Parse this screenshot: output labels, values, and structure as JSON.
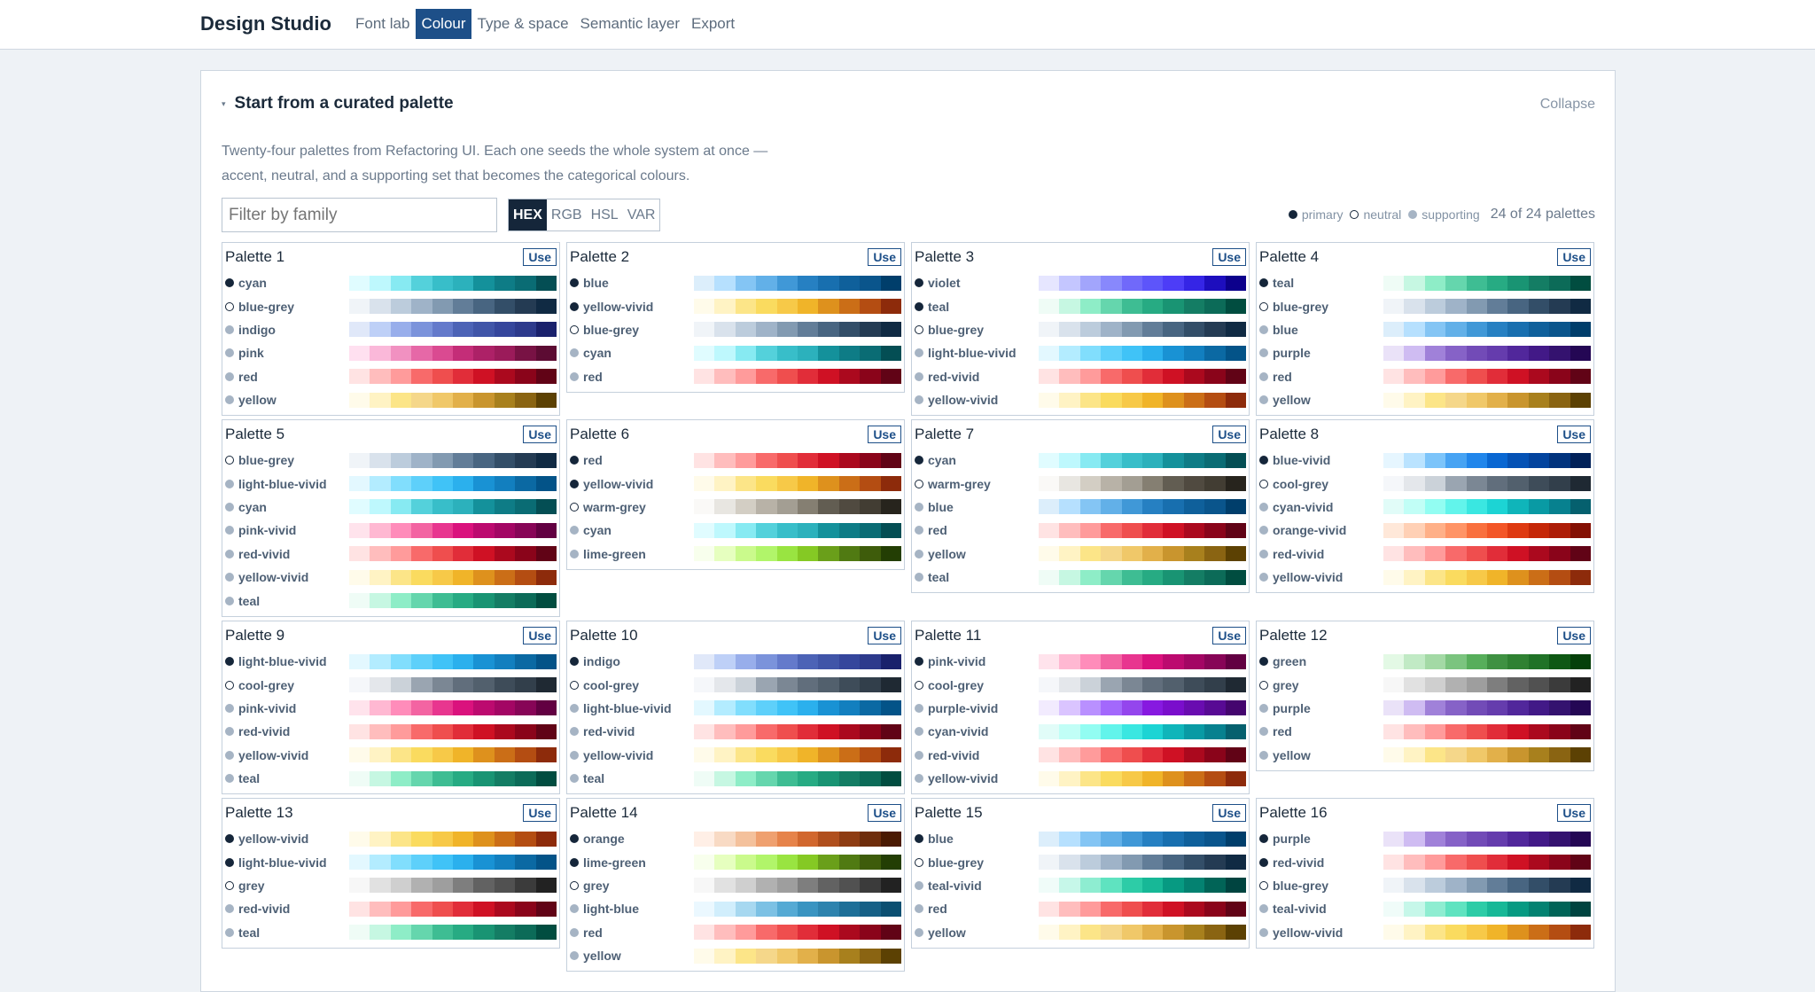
{
  "app": {
    "title": "Design Studio"
  },
  "nav": [
    {
      "label": "Font lab",
      "active": false
    },
    {
      "label": "Colour",
      "active": true
    },
    {
      "label": "Type & space",
      "active": false
    },
    {
      "label": "Semantic layer",
      "active": false
    },
    {
      "label": "Export",
      "active": false
    }
  ],
  "section": {
    "title": "Start from a curated palette",
    "collapse_label": "Collapse",
    "description_line1": "Twenty-four palettes from Refactoring UI. Each one seeds the whole system at once —",
    "description_line2": "accent, neutral, and a supporting set that becomes the categorical colours.",
    "filter_placeholder": "Filter by family",
    "formats": [
      {
        "label": "HEX",
        "active": true
      },
      {
        "label": "RGB",
        "active": false
      },
      {
        "label": "HSL",
        "active": false
      },
      {
        "label": "VAR",
        "active": false
      }
    ],
    "legend": {
      "primary": "primary",
      "neutral": "neutral",
      "supporting": "supporting"
    },
    "count_label": "24 of 24 palettes"
  },
  "use_label": "Use",
  "colors": {
    "primary_dot": "#15263a",
    "supporting_dot": "#a6b4c4",
    "accent": "#1d4f88"
  },
  "ramps": {
    "cyan": [
      "#e0fcff",
      "#bef8fd",
      "#87eaf2",
      "#54d1db",
      "#38bec9",
      "#2cb1bc",
      "#14919b",
      "#0e7c86",
      "#0a6c74",
      "#044e54"
    ],
    "blue-grey": [
      "#f0f4f8",
      "#d9e2ec",
      "#bcccdc",
      "#9fb3c8",
      "#829ab1",
      "#627d98",
      "#486581",
      "#334e68",
      "#243b53",
      "#102a43"
    ],
    "indigo": [
      "#e0e8f9",
      "#bed0f7",
      "#98aeeb",
      "#7b93db",
      "#647acb",
      "#4c63b6",
      "#4055a8",
      "#35469c",
      "#2d3a8c",
      "#19216c"
    ],
    "pink": [
      "#ffe0f0",
      "#fab8d9",
      "#f191c1",
      "#e668a7",
      "#da4a91",
      "#c42d78",
      "#ad2167",
      "#9b1b5a",
      "#781244",
      "#5c0b33"
    ],
    "red": [
      "#ffe3e3",
      "#ffbdbd",
      "#ff9b9b",
      "#f86a6a",
      "#ef4e4e",
      "#e12d39",
      "#cf1124",
      "#ab091e",
      "#8a041a",
      "#610316"
    ],
    "yellow": [
      "#fffbea",
      "#fff3c4",
      "#fce588",
      "#fadb5f",
      "#f7c948",
      "#f0b429",
      "#de911d",
      "#cb6e17",
      "#b44d12",
      "#8d2b0b"
    ],
    "yellow-o": [
      "#fffbea",
      "#fff3c4",
      "#fce588",
      "#f5d78a",
      "#f0c869",
      "#e2b04a",
      "#c9952e",
      "#a8801d",
      "#8a6412",
      "#5c4103"
    ],
    "blue": [
      "#dceefb",
      "#b6e0fe",
      "#84c5f4",
      "#62b0e8",
      "#4098d7",
      "#2680c2",
      "#186faf",
      "#0f609b",
      "#0a558c",
      "#003e6b"
    ],
    "yellow-vivid": [
      "#fffbea",
      "#fff3c4",
      "#fce588",
      "#fadb5f",
      "#f7c948",
      "#f0b429",
      "#de911d",
      "#cb6e17",
      "#b44d12",
      "#8d2b0b"
    ],
    "violet": [
      "#e6e6ff",
      "#c4c6ff",
      "#a2a5fc",
      "#8888fc",
      "#7069fa",
      "#5d55fa",
      "#4d3df7",
      "#3525e6",
      "#1d0ebe",
      "#0c008c"
    ],
    "teal": [
      "#effcf6",
      "#c6f7e2",
      "#8eedc7",
      "#65d6ad",
      "#3ebd93",
      "#27ab83",
      "#199473",
      "#147d64",
      "#0c6b58",
      "#014d40"
    ],
    "light-blue-vivid": [
      "#e3f8ff",
      "#b3ecff",
      "#81defd",
      "#5ed0fa",
      "#40c3f7",
      "#2bb0ed",
      "#1992d4",
      "#127fbf",
      "#0b69a3",
      "#035388"
    ],
    "red-vivid": [
      "#ffe3e3",
      "#ffbdbd",
      "#ff9b9b",
      "#f86a6a",
      "#ef4e4e",
      "#e12d39",
      "#cf1124",
      "#ab091e",
      "#8a041a",
      "#610316"
    ],
    "purple": [
      "#eae2f8",
      "#cfbcf2",
      "#a081d9",
      "#8662c7",
      "#724bb7",
      "#653cad",
      "#51279b",
      "#421987",
      "#34126f",
      "#240754"
    ],
    "pink-vivid": [
      "#ffe3ec",
      "#ffb8d2",
      "#ff8cba",
      "#f364a2",
      "#e8368f",
      "#da127d",
      "#bc0a6f",
      "#a30664",
      "#870557",
      "#620042"
    ],
    "warm-grey": [
      "#faf9f7",
      "#e8e6e1",
      "#d3cec4",
      "#b8b2a7",
      "#a39e93",
      "#857f72",
      "#625d52",
      "#504a40",
      "#423d33",
      "#27241d"
    ],
    "lime-green": [
      "#f8ffed",
      "#e6ffbf",
      "#cafa8c",
      "#b1f56a",
      "#99e441",
      "#85c924",
      "#6a9f1a",
      "#507a12",
      "#3e5c0b",
      "#233e04"
    ],
    "blue-vivid": [
      "#e6f6ff",
      "#bae3ff",
      "#7cc4fa",
      "#47a3f3",
      "#2186eb",
      "#0967d2",
      "#0552b5",
      "#03449e",
      "#01337d",
      "#002159"
    ],
    "cool-grey": [
      "#f5f7fa",
      "#e4e7eb",
      "#cbd2d9",
      "#9aa5b1",
      "#7b8794",
      "#616e7c",
      "#52606d",
      "#3e4c59",
      "#323f4b",
      "#1f2933"
    ],
    "cyan-vivid": [
      "#e1fcf8",
      "#c1fef6",
      "#92fdf2",
      "#62f4eb",
      "#3ae7e1",
      "#1cd4d4",
      "#0fb5ba",
      "#099aa4",
      "#07818f",
      "#05606e"
    ],
    "orange-vivid": [
      "#ffe8d9",
      "#ffd0b5",
      "#ffb088",
      "#ff9466",
      "#f9703e",
      "#f35627",
      "#de3a11",
      "#c52707",
      "#ad1d07",
      "#841003"
    ],
    "grey": [
      "#f7f7f7",
      "#e1e1e1",
      "#cfcfcf",
      "#b1b1b1",
      "#9e9e9e",
      "#7e7e7e",
      "#626262",
      "#515151",
      "#3b3b3b",
      "#222222"
    ],
    "green": [
      "#e3f9e5",
      "#c1eac5",
      "#a3d9a5",
      "#7bc47f",
      "#57ae5b",
      "#3f9142",
      "#2f8132",
      "#207227",
      "#0e5814",
      "#05400a"
    ],
    "purple-vivid": [
      "#f2ebfe",
      "#dac4ff",
      "#b990ff",
      "#a368fc",
      "#9446ed",
      "#8719e0",
      "#7a0ecc",
      "#690cb0",
      "#580a94",
      "#44056e"
    ],
    "teal-vivid": [
      "#f0fcf9",
      "#c6f7e9",
      "#8eedd1",
      "#5fe3c0",
      "#2dcca7",
      "#17b897",
      "#079a82",
      "#048271",
      "#016457",
      "#004440"
    ],
    "orange": [
      "#fffaeb",
      "#fcefc7",
      "#f8e3a3",
      "#f9da8b",
      "#f7d070",
      "#e9b949",
      "#c99a2e",
      "#a27c1a",
      "#7c5e10",
      "#513c06"
    ],
    "orange-r": [
      "#ffefe6",
      "#f8dac4",
      "#f4c19c",
      "#efa06f",
      "#e6834a",
      "#d1672e",
      "#b04f1d",
      "#8e3c12",
      "#6e2d0b",
      "#4a1a02"
    ],
    "light-blue": [
      "#ebf8ff",
      "#d1eefc",
      "#a7d8f0",
      "#7cc1e4",
      "#55aad4",
      "#3994c1",
      "#2d83ae",
      "#1d6f98",
      "#166086",
      "#0b4f71"
    ]
  },
  "palettes": [
    {
      "name": "Palette 1",
      "rows": [
        {
          "role": "primary",
          "family": "cyan",
          "ramp": "cyan"
        },
        {
          "role": "neutral",
          "family": "blue-grey",
          "ramp": "blue-grey"
        },
        {
          "role": "supporting",
          "family": "indigo",
          "ramp": "indigo"
        },
        {
          "role": "supporting",
          "family": "pink",
          "ramp": "pink"
        },
        {
          "role": "supporting",
          "family": "red",
          "ramp": "red"
        },
        {
          "role": "supporting",
          "family": "yellow",
          "ramp": "yellow-o"
        }
      ]
    },
    {
      "name": "Palette 2",
      "rows": [
        {
          "role": "primary",
          "family": "blue",
          "ramp": "blue"
        },
        {
          "role": "primary",
          "family": "yellow-vivid",
          "ramp": "yellow-vivid"
        },
        {
          "role": "neutral",
          "family": "blue-grey",
          "ramp": "blue-grey"
        },
        {
          "role": "supporting",
          "family": "cyan",
          "ramp": "cyan"
        },
        {
          "role": "supporting",
          "family": "red",
          "ramp": "red"
        }
      ]
    },
    {
      "name": "Palette 3",
      "rows": [
        {
          "role": "primary",
          "family": "violet",
          "ramp": "violet"
        },
        {
          "role": "primary",
          "family": "teal",
          "ramp": "teal"
        },
        {
          "role": "neutral",
          "family": "blue-grey",
          "ramp": "blue-grey"
        },
        {
          "role": "supporting",
          "family": "light-blue-vivid",
          "ramp": "light-blue-vivid"
        },
        {
          "role": "supporting",
          "family": "red-vivid",
          "ramp": "red-vivid"
        },
        {
          "role": "supporting",
          "family": "yellow-vivid",
          "ramp": "yellow-vivid"
        }
      ]
    },
    {
      "name": "Palette 4",
      "rows": [
        {
          "role": "primary",
          "family": "teal",
          "ramp": "teal"
        },
        {
          "role": "neutral",
          "family": "blue-grey",
          "ramp": "blue-grey"
        },
        {
          "role": "supporting",
          "family": "blue",
          "ramp": "blue"
        },
        {
          "role": "supporting",
          "family": "purple",
          "ramp": "purple"
        },
        {
          "role": "supporting",
          "family": "red",
          "ramp": "red"
        },
        {
          "role": "supporting",
          "family": "yellow",
          "ramp": "yellow-o"
        }
      ]
    },
    {
      "name": "Palette 5",
      "rows": [
        {
          "role": "neutral",
          "family": "blue-grey",
          "ramp": "blue-grey"
        },
        {
          "role": "supporting",
          "family": "light-blue-vivid",
          "ramp": "light-blue-vivid"
        },
        {
          "role": "supporting",
          "family": "cyan",
          "ramp": "cyan"
        },
        {
          "role": "supporting",
          "family": "pink-vivid",
          "ramp": "pink-vivid"
        },
        {
          "role": "supporting",
          "family": "red-vivid",
          "ramp": "red-vivid"
        },
        {
          "role": "supporting",
          "family": "yellow-vivid",
          "ramp": "yellow-vivid"
        },
        {
          "role": "supporting",
          "family": "teal",
          "ramp": "teal"
        }
      ]
    },
    {
      "name": "Palette 6",
      "rows": [
        {
          "role": "primary",
          "family": "red",
          "ramp": "red"
        },
        {
          "role": "primary",
          "family": "yellow-vivid",
          "ramp": "yellow-vivid"
        },
        {
          "role": "neutral",
          "family": "warm-grey",
          "ramp": "warm-grey"
        },
        {
          "role": "supporting",
          "family": "cyan",
          "ramp": "cyan"
        },
        {
          "role": "supporting",
          "family": "lime-green",
          "ramp": "lime-green"
        }
      ]
    },
    {
      "name": "Palette 7",
      "rows": [
        {
          "role": "primary",
          "family": "cyan",
          "ramp": "cyan"
        },
        {
          "role": "neutral",
          "family": "warm-grey",
          "ramp": "warm-grey"
        },
        {
          "role": "supporting",
          "family": "blue",
          "ramp": "blue"
        },
        {
          "role": "supporting",
          "family": "red",
          "ramp": "red"
        },
        {
          "role": "supporting",
          "family": "yellow",
          "ramp": "yellow-o"
        },
        {
          "role": "supporting",
          "family": "teal",
          "ramp": "teal"
        }
      ]
    },
    {
      "name": "Palette 8",
      "rows": [
        {
          "role": "primary",
          "family": "blue-vivid",
          "ramp": "blue-vivid"
        },
        {
          "role": "neutral",
          "family": "cool-grey",
          "ramp": "cool-grey"
        },
        {
          "role": "supporting",
          "family": "cyan-vivid",
          "ramp": "cyan-vivid"
        },
        {
          "role": "supporting",
          "family": "orange-vivid",
          "ramp": "orange-vivid"
        },
        {
          "role": "supporting",
          "family": "red-vivid",
          "ramp": "red-vivid"
        },
        {
          "role": "supporting",
          "family": "yellow-vivid",
          "ramp": "yellow-vivid"
        }
      ]
    },
    {
      "name": "Palette 9",
      "rows": [
        {
          "role": "primary",
          "family": "light-blue-vivid",
          "ramp": "light-blue-vivid"
        },
        {
          "role": "neutral",
          "family": "cool-grey",
          "ramp": "cool-grey"
        },
        {
          "role": "supporting",
          "family": "pink-vivid",
          "ramp": "pink-vivid"
        },
        {
          "role": "supporting",
          "family": "red-vivid",
          "ramp": "red-vivid"
        },
        {
          "role": "supporting",
          "family": "yellow-vivid",
          "ramp": "yellow-vivid"
        },
        {
          "role": "supporting",
          "family": "teal",
          "ramp": "teal"
        }
      ]
    },
    {
      "name": "Palette 10",
      "rows": [
        {
          "role": "primary",
          "family": "indigo",
          "ramp": "indigo"
        },
        {
          "role": "neutral",
          "family": "cool-grey",
          "ramp": "cool-grey"
        },
        {
          "role": "supporting",
          "family": "light-blue-vivid",
          "ramp": "light-blue-vivid"
        },
        {
          "role": "supporting",
          "family": "red-vivid",
          "ramp": "red-vivid"
        },
        {
          "role": "supporting",
          "family": "yellow-vivid",
          "ramp": "yellow-vivid"
        },
        {
          "role": "supporting",
          "family": "teal",
          "ramp": "teal"
        }
      ]
    },
    {
      "name": "Palette 11",
      "rows": [
        {
          "role": "primary",
          "family": "pink-vivid",
          "ramp": "pink-vivid"
        },
        {
          "role": "neutral",
          "family": "cool-grey",
          "ramp": "cool-grey"
        },
        {
          "role": "supporting",
          "family": "purple-vivid",
          "ramp": "purple-vivid"
        },
        {
          "role": "supporting",
          "family": "cyan-vivid",
          "ramp": "cyan-vivid"
        },
        {
          "role": "supporting",
          "family": "red-vivid",
          "ramp": "red-vivid"
        },
        {
          "role": "supporting",
          "family": "yellow-vivid",
          "ramp": "yellow-vivid"
        }
      ]
    },
    {
      "name": "Palette 12",
      "rows": [
        {
          "role": "primary",
          "family": "green",
          "ramp": "green"
        },
        {
          "role": "neutral",
          "family": "grey",
          "ramp": "grey"
        },
        {
          "role": "supporting",
          "family": "purple",
          "ramp": "purple"
        },
        {
          "role": "supporting",
          "family": "red",
          "ramp": "red"
        },
        {
          "role": "supporting",
          "family": "yellow",
          "ramp": "yellow-o"
        }
      ]
    },
    {
      "name": "Palette 13",
      "rows": [
        {
          "role": "primary",
          "family": "yellow-vivid",
          "ramp": "yellow-vivid"
        },
        {
          "role": "primary",
          "family": "light-blue-vivid",
          "ramp": "light-blue-vivid"
        },
        {
          "role": "neutral",
          "family": "grey",
          "ramp": "grey"
        },
        {
          "role": "supporting",
          "family": "red-vivid",
          "ramp": "red-vivid"
        },
        {
          "role": "supporting",
          "family": "teal",
          "ramp": "teal"
        }
      ]
    },
    {
      "name": "Palette 14",
      "rows": [
        {
          "role": "primary",
          "family": "orange",
          "ramp": "orange-r"
        },
        {
          "role": "primary",
          "family": "lime-green",
          "ramp": "lime-green"
        },
        {
          "role": "neutral",
          "family": "grey",
          "ramp": "grey"
        },
        {
          "role": "supporting",
          "family": "light-blue",
          "ramp": "light-blue"
        },
        {
          "role": "supporting",
          "family": "red",
          "ramp": "red"
        },
        {
          "role": "supporting",
          "family": "yellow",
          "ramp": "yellow-o"
        }
      ]
    },
    {
      "name": "Palette 15",
      "rows": [
        {
          "role": "primary",
          "family": "blue",
          "ramp": "blue"
        },
        {
          "role": "neutral",
          "family": "blue-grey",
          "ramp": "blue-grey"
        },
        {
          "role": "supporting",
          "family": "teal-vivid",
          "ramp": "teal-vivid"
        },
        {
          "role": "supporting",
          "family": "red",
          "ramp": "red"
        },
        {
          "role": "supporting",
          "family": "yellow",
          "ramp": "yellow-o"
        }
      ]
    },
    {
      "name": "Palette 16",
      "rows": [
        {
          "role": "primary",
          "family": "purple",
          "ramp": "purple"
        },
        {
          "role": "primary",
          "family": "red-vivid",
          "ramp": "red-vivid"
        },
        {
          "role": "neutral",
          "family": "blue-grey",
          "ramp": "blue-grey"
        },
        {
          "role": "supporting",
          "family": "teal-vivid",
          "ramp": "teal-vivid"
        },
        {
          "role": "supporting",
          "family": "yellow-vivid",
          "ramp": "yellow-vivid"
        }
      ]
    }
  ]
}
